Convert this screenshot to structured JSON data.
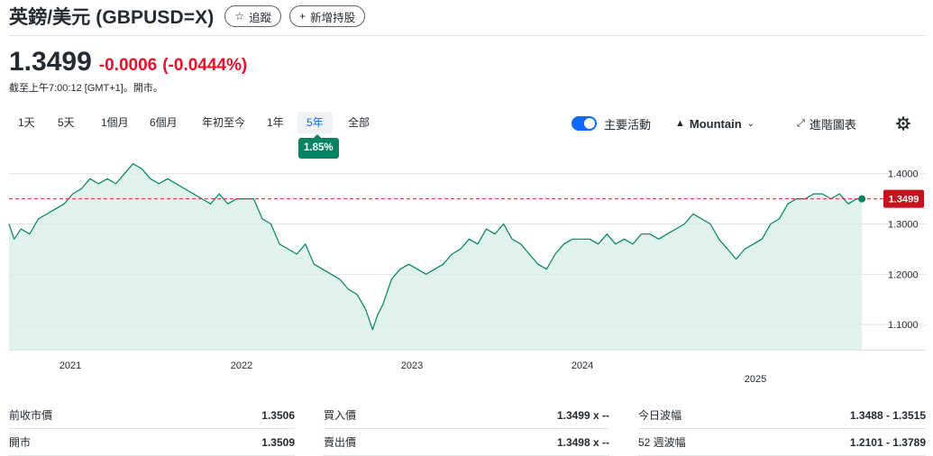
{
  "header": {
    "title": "英鎊/美元 (GBPUSD=X)",
    "follow_label": "追蹤",
    "follow_icon": "star-outline-icon",
    "add_label": "新增持股",
    "add_icon": "plus-icon"
  },
  "quote": {
    "price": "1.3499",
    "change": "-0.0006",
    "change_pct": "(-0.0444%)",
    "timestamp": "截至上午7:00:12 [GMT+1]。開市。",
    "change_color": "#eb0f29"
  },
  "range_tabs": [
    {
      "label": "1天",
      "active": false
    },
    {
      "label": "5天",
      "active": false
    },
    {
      "label": "1個月",
      "active": false
    },
    {
      "label": "6個月",
      "active": false
    },
    {
      "label": "年初至今",
      "active": false
    },
    {
      "label": "1年",
      "active": false
    },
    {
      "label": "5年",
      "active": true
    },
    {
      "label": "全部",
      "active": false
    }
  ],
  "range_performance": "1.85%",
  "controls": {
    "events_label": "主要活動",
    "events_on": true,
    "chart_type_label": "Mountain",
    "chart_type_icon": "mountain-icon",
    "advanced_label": "進階圖表",
    "advanced_icon": "expand-arrows-icon",
    "settings_icon": "gear-icon"
  },
  "chart_data": {
    "type": "area",
    "x_tick_labels": [
      "2021",
      "2022",
      "2023",
      "2024",
      "2025"
    ],
    "y_tick_labels": [
      "1.4000",
      "1.3000",
      "1.2000",
      "1.1000"
    ],
    "y_ticks": [
      1.4,
      1.3,
      1.2,
      1.1
    ],
    "ylim": [
      1.05,
      1.43
    ],
    "xlim": [
      2020.63,
      2025.6
    ],
    "grid": true,
    "current_price": 1.3499,
    "current_price_label": "1.3499",
    "line_color": "#008463",
    "fill_color": "#d7ece5",
    "price_line_color": "#d9263a",
    "series": [
      {
        "x": [
          2020.63,
          2020.66,
          2020.7,
          2020.75,
          2020.8,
          2020.85,
          2020.9,
          2020.95,
          2021.0,
          2021.05,
          2021.1,
          2021.15,
          2021.2,
          2021.25,
          2021.3,
          2021.35,
          2021.4,
          2021.45,
          2021.5,
          2021.55,
          2021.6,
          2021.65,
          2021.7,
          2021.75,
          2021.8,
          2021.85,
          2021.9,
          2021.95,
          2022.0,
          2022.05,
          2022.1,
          2022.15,
          2022.2,
          2022.25,
          2022.3,
          2022.35,
          2022.4,
          2022.45,
          2022.5,
          2022.55,
          2022.6,
          2022.65,
          2022.7,
          2022.74,
          2022.77,
          2022.8,
          2022.85,
          2022.9,
          2022.95,
          2023.0,
          2023.05,
          2023.1,
          2023.15,
          2023.2,
          2023.25,
          2023.3,
          2023.35,
          2023.4,
          2023.45,
          2023.5,
          2023.55,
          2023.6,
          2023.65,
          2023.7,
          2023.75,
          2023.8,
          2023.85,
          2023.9,
          2023.95,
          2024.0,
          2024.05,
          2024.1,
          2024.15,
          2024.2,
          2024.25,
          2024.3,
          2024.35,
          2024.4,
          2024.45,
          2024.5,
          2024.55,
          2024.6,
          2024.65,
          2024.7,
          2024.75,
          2024.8,
          2024.85,
          2024.9,
          2024.95,
          2025.0,
          2025.05,
          2025.1,
          2025.15,
          2025.2,
          2025.25,
          2025.3,
          2025.35,
          2025.4,
          2025.45,
          2025.5,
          2025.55,
          2025.58
        ],
        "y": [
          1.3,
          1.27,
          1.29,
          1.28,
          1.31,
          1.32,
          1.33,
          1.34,
          1.36,
          1.37,
          1.39,
          1.38,
          1.39,
          1.38,
          1.4,
          1.42,
          1.41,
          1.39,
          1.38,
          1.39,
          1.38,
          1.37,
          1.36,
          1.35,
          1.34,
          1.36,
          1.34,
          1.35,
          1.35,
          1.35,
          1.31,
          1.3,
          1.26,
          1.25,
          1.24,
          1.26,
          1.22,
          1.21,
          1.2,
          1.19,
          1.17,
          1.16,
          1.13,
          1.09,
          1.12,
          1.14,
          1.19,
          1.21,
          1.22,
          1.21,
          1.2,
          1.21,
          1.22,
          1.24,
          1.25,
          1.27,
          1.26,
          1.29,
          1.28,
          1.3,
          1.27,
          1.26,
          1.24,
          1.22,
          1.21,
          1.24,
          1.26,
          1.27,
          1.27,
          1.27,
          1.26,
          1.28,
          1.26,
          1.27,
          1.26,
          1.28,
          1.28,
          1.27,
          1.28,
          1.29,
          1.3,
          1.32,
          1.31,
          1.3,
          1.27,
          1.25,
          1.23,
          1.25,
          1.26,
          1.27,
          1.3,
          1.31,
          1.34,
          1.35,
          1.35,
          1.36,
          1.36,
          1.35,
          1.36,
          1.34,
          1.35,
          1.35
        ]
      }
    ]
  },
  "stats": [
    [
      {
        "label": "前收市價",
        "value": "1.3506"
      },
      {
        "label": "買入價",
        "value": "1.3499 x --"
      },
      {
        "label": "今日波幅",
        "value": "1.3488 - 1.3515"
      }
    ],
    [
      {
        "label": "開市",
        "value": "1.3509"
      },
      {
        "label": "賣出價",
        "value": "1.3498 x --"
      },
      {
        "label": "52 週波幅",
        "value": "1.2101 - 1.3789"
      }
    ]
  ]
}
